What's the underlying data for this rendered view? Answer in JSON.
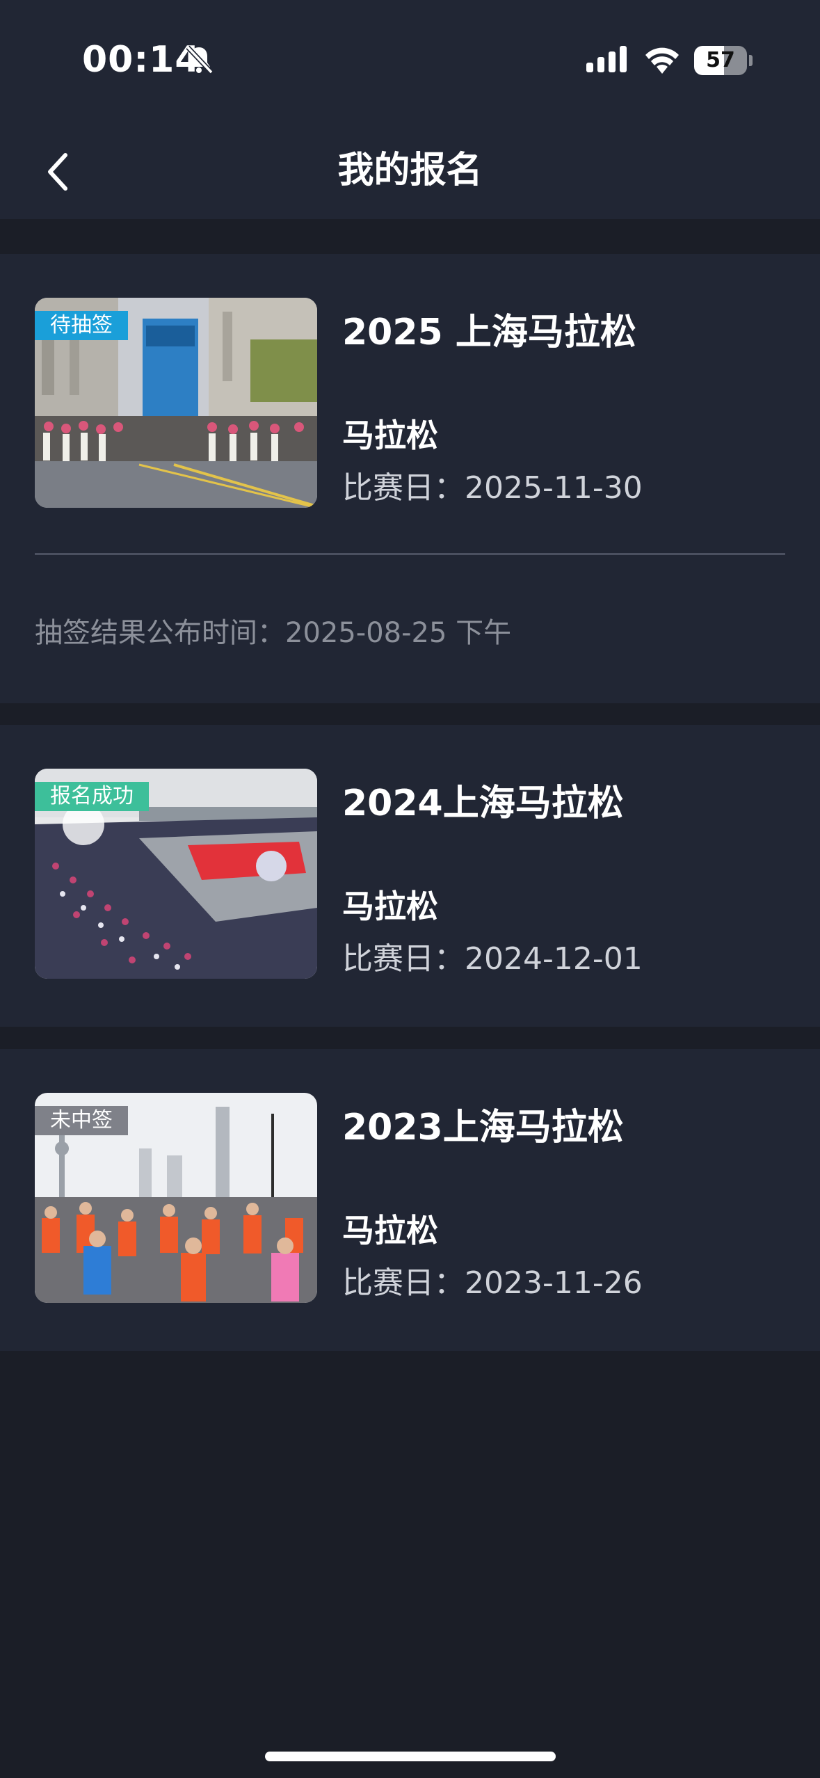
{
  "status_bar": {
    "time": "00:14",
    "battery": "57",
    "battery_level": 0.57
  },
  "nav": {
    "title": "我的报名"
  },
  "events": [
    {
      "badge": "待抽签",
      "badge_color": "#1a9fd9",
      "title": "2025 上海马拉松",
      "type": "马拉松",
      "date": "比赛日：2025-11-30",
      "draw_time": "抽签结果公布时间：2025-08-25  下午"
    },
    {
      "badge": "报名成功",
      "badge_color": "#3dbf9a",
      "title": "2024上海马拉松",
      "type": "马拉松",
      "date": "比赛日：2024-12-01"
    },
    {
      "badge": "未中签",
      "badge_color": "#7f8189",
      "title": "2023上海马拉松",
      "type": "马拉松",
      "date": "比赛日：2023-11-26"
    }
  ]
}
